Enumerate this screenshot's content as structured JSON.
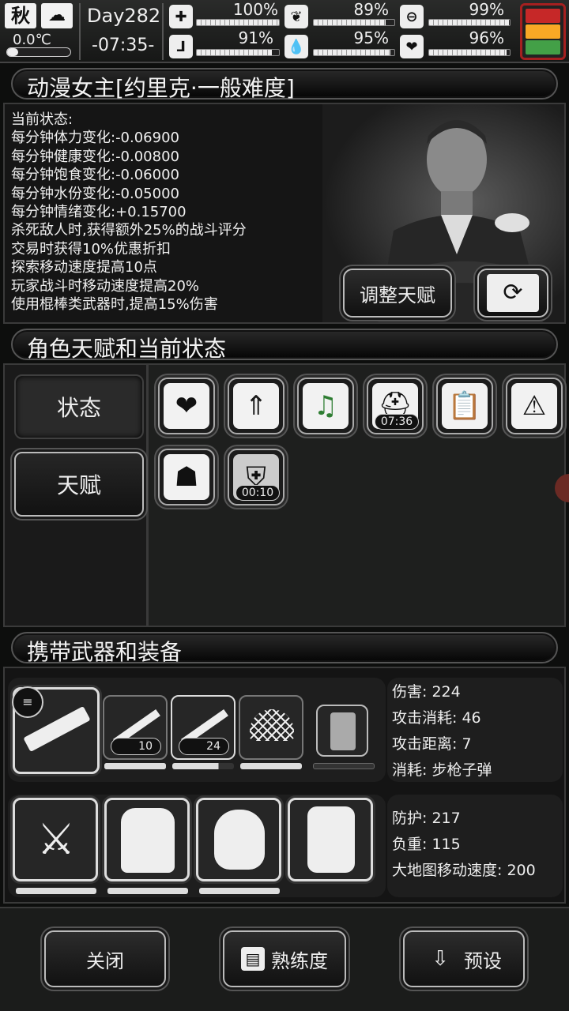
{
  "topbar": {
    "season": "秋",
    "temperature": "0.0℃",
    "day": "Day282",
    "time": "-07:35-",
    "stats": [
      {
        "name": "health",
        "icon": "medkit-icon",
        "value": "100%",
        "fill": 1.0
      },
      {
        "name": "hunger",
        "icon": "stomach-icon",
        "value": "89%",
        "fill": 0.89
      },
      {
        "name": "pill",
        "icon": "pill-icon",
        "value": "99%",
        "fill": 0.99
      },
      {
        "name": "stamina",
        "icon": "boot-icon",
        "value": "91%",
        "fill": 0.91
      },
      {
        "name": "water",
        "icon": "water-drop-icon",
        "value": "95%",
        "fill": 0.95
      },
      {
        "name": "mood",
        "icon": "heart-icon",
        "value": "96%",
        "fill": 0.96
      }
    ]
  },
  "character": {
    "title": "动漫女主[约里克·一般难度]",
    "status_header": "当前状态:",
    "status_lines": [
      "每分钟体力变化:-0.06900",
      "每分钟健康变化:-0.00800",
      "每分钟饱食变化:-0.06000",
      "每分钟水份变化:-0.05000",
      "每分钟情绪变化:+0.15700",
      "杀死敌人时,获得额外25%的战斗评分",
      "交易时获得10%优惠折扣",
      "探索移动速度提高10点",
      "玩家战斗时移动速度提高20%",
      "使用棍棒类武器时,提高15%伤害"
    ],
    "adjust_talent_label": "调整天赋"
  },
  "talents": {
    "title": "角色天赋和当前状态",
    "tab_status": "状态",
    "tab_talent": "天赋",
    "icons": [
      {
        "icon": "heart-icon",
        "timer": ""
      },
      {
        "icon": "stomach-boost-icon",
        "timer": ""
      },
      {
        "icon": "music-heart-icon",
        "timer": ""
      },
      {
        "icon": "helmet-up-icon",
        "timer": "07:36"
      },
      {
        "icon": "clipboard-bandage-icon",
        "timer": ""
      },
      {
        "icon": "alarm-light-icon",
        "timer": ""
      },
      {
        "icon": "person-heartbeat-icon",
        "timer": ""
      },
      {
        "icon": "armor-vest-icon",
        "timer": "00:10"
      }
    ]
  },
  "equipment": {
    "title": "携带武器和装备",
    "weapons": [
      {
        "icon": "assault-rifle-icon",
        "count": "",
        "durability": 1.0
      },
      {
        "icon": "rifle-bayonet-icon",
        "count": "10",
        "durability": 1.0
      },
      {
        "icon": "rifle-ammo-icon",
        "count": "24",
        "durability": 0.75
      },
      {
        "icon": "net-icon",
        "count": "",
        "durability": 1.0
      },
      {
        "icon": "riot-shield-icon",
        "count": "",
        "durability": 0
      }
    ],
    "weapon_stats": [
      "伤害: 224",
      "攻击消耗: 46",
      "攻击距离: 7",
      "消耗: 步枪子弹"
    ],
    "armor": [
      {
        "icon": "leg-guards-icon",
        "durability": 1.0
      },
      {
        "icon": "body-armor-icon",
        "durability": 1.0
      },
      {
        "icon": "gas-mask-icon",
        "durability": 1.0
      },
      {
        "icon": "backpack-icon",
        "durability": 0
      }
    ],
    "armor_stats": [
      "防护: 217",
      "负重: 115",
      "大地图移动速度: 200"
    ]
  },
  "footer": {
    "close_label": "关闭",
    "proficiency_label": "熟练度",
    "preset_label": "预设"
  },
  "colors": {
    "background": "#0d0e0d",
    "panel": "#1e1f1e",
    "accent_red": "#c62828",
    "accent_yellow": "#f9a825",
    "accent_green": "#43a047"
  }
}
